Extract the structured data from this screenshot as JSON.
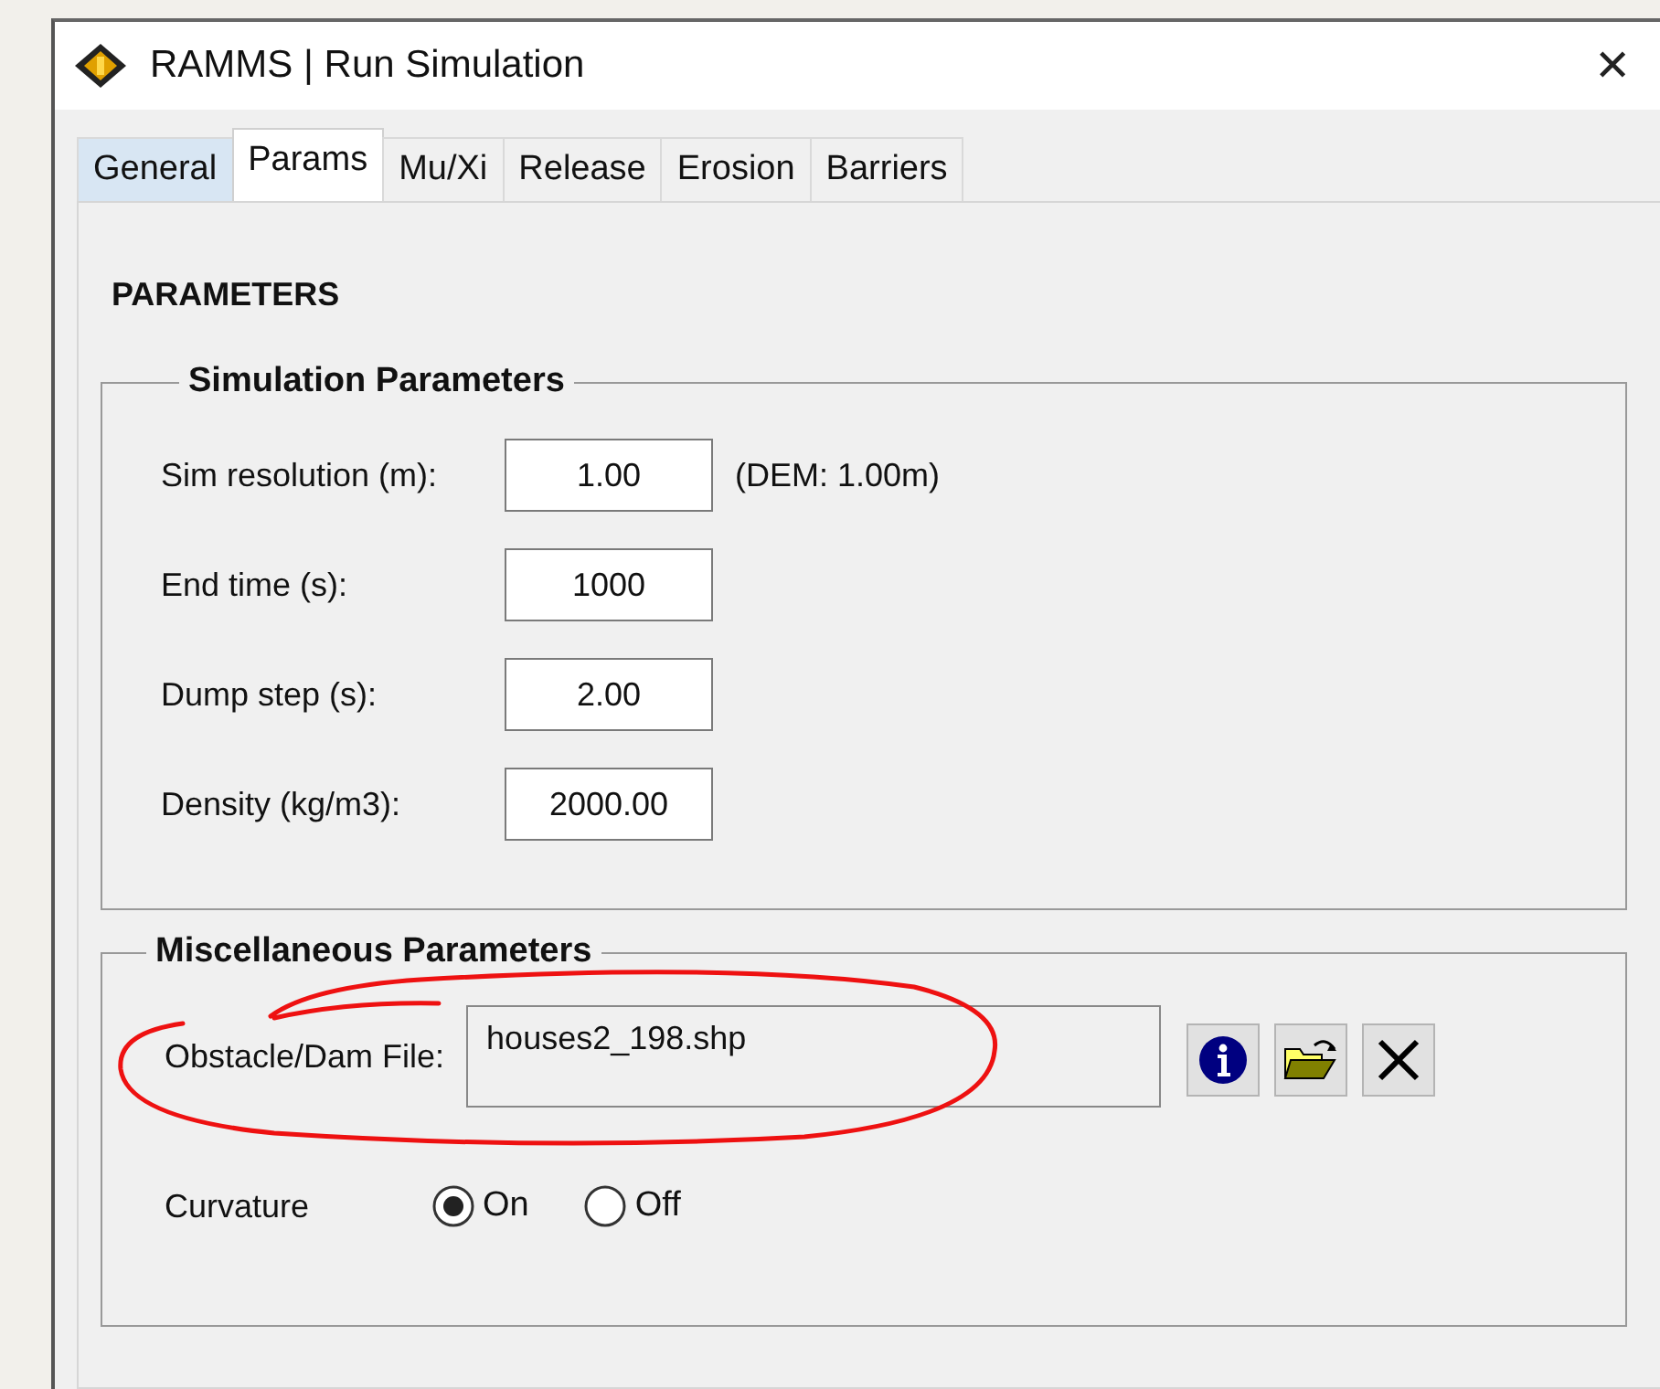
{
  "window": {
    "title": "RAMMS | Run Simulation",
    "close": "✕"
  },
  "tabs": [
    {
      "label": "General",
      "selected": false,
      "hover": true
    },
    {
      "label": "Params",
      "selected": true,
      "hover": false
    },
    {
      "label": "Mu/Xi",
      "selected": false,
      "hover": false
    },
    {
      "label": "Release",
      "selected": false,
      "hover": false
    },
    {
      "label": "Erosion",
      "selected": false,
      "hover": false
    },
    {
      "label": "Barriers",
      "selected": false,
      "hover": false
    }
  ],
  "heading": "PARAMETERS",
  "simulation_parameters": {
    "title": "Simulation Parameters",
    "fields": [
      {
        "label": "Sim resolution (m):",
        "value": "1.00",
        "note": "(DEM: 1.00m)"
      },
      {
        "label": "End time (s):",
        "value": "1000"
      },
      {
        "label": "Dump step (s):",
        "value": "2.00"
      },
      {
        "label": "Density (kg/m3):",
        "value": "2000.00"
      }
    ]
  },
  "miscellaneous_parameters": {
    "title": "Miscellaneous Parameters",
    "file": {
      "label": "Obstacle/Dam File:",
      "value": "houses2_198.shp"
    },
    "buttons": [
      {
        "kind": "info"
      },
      {
        "kind": "open"
      },
      {
        "kind": "clear"
      }
    ],
    "curvature": {
      "label": "Curvature",
      "options": [
        {
          "label": "On",
          "selected": true
        },
        {
          "label": "Off",
          "selected": false
        }
      ]
    }
  }
}
